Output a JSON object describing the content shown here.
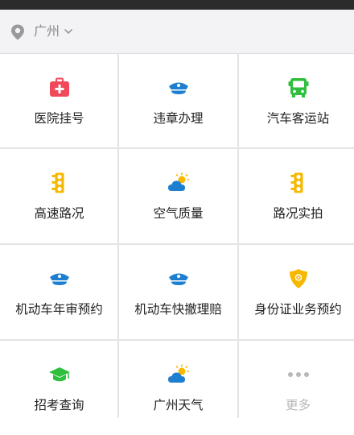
{
  "location": {
    "city": "广州",
    "icon": "location-pin-icon",
    "dropdown_icon": "chevron-down-icon"
  },
  "colors": {
    "red": "#f0495a",
    "blue": "#1e7fd0",
    "green": "#2fbf3c",
    "yellow": "#f6b800",
    "gray": "#b8b8b8"
  },
  "services": [
    {
      "label": "医院挂号",
      "icon": "medical-kit-icon"
    },
    {
      "label": "违章办理",
      "icon": "police-cap-icon"
    },
    {
      "label": "汽车客运站",
      "icon": "bus-icon"
    },
    {
      "label": "高速路况",
      "icon": "traffic-light-icon"
    },
    {
      "label": "空气质量",
      "icon": "weather-sun-cloud-icon"
    },
    {
      "label": "路况实拍",
      "icon": "traffic-light-icon"
    },
    {
      "label": "机动车年审预约",
      "icon": "police-cap-icon"
    },
    {
      "label": "机动车快撤理赔",
      "icon": "police-cap-icon"
    },
    {
      "label": "身份证业务预约",
      "icon": "police-badge-icon"
    },
    {
      "label": "招考查询",
      "icon": "graduation-cap-icon"
    },
    {
      "label": "广州天气",
      "icon": "weather-sun-cloud-icon"
    },
    {
      "label": "更多",
      "icon": "more-dots-icon"
    }
  ]
}
